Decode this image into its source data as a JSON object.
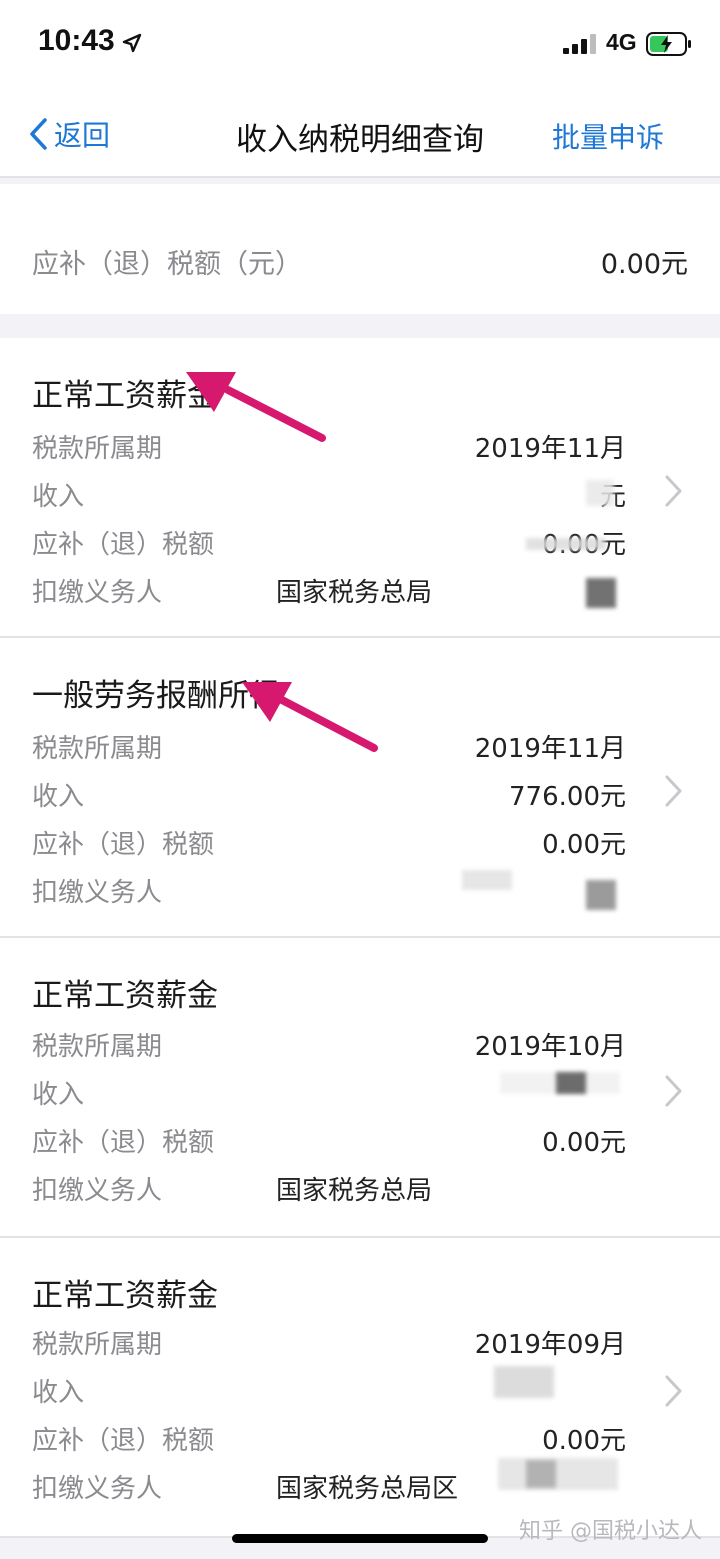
{
  "status_bar": {
    "time": "10:43",
    "network": "4G",
    "icons": [
      "location-arrow-icon",
      "signal-icon",
      "battery-charging-icon"
    ]
  },
  "nav": {
    "back_label": "返回",
    "title": "收入纳税明细查询",
    "action_label": "批量申诉"
  },
  "summary": {
    "label": "应补（退）税额（元）",
    "value": "0.00元"
  },
  "labels": {
    "period": "税款所属期",
    "income": "收入",
    "tax": "应补（退）税额",
    "agent": "扣缴义务人"
  },
  "records": [
    {
      "title": "正常工资薪金",
      "period": "2019年11月",
      "income": "元",
      "tax": "0.00元",
      "agent": "国家税务总局"
    },
    {
      "title": "一般劳务报酬所得",
      "period": "2019年11月",
      "income": "776.00元",
      "tax": "0.00元",
      "agent": ""
    },
    {
      "title": "正常工资薪金",
      "period": "2019年10月",
      "income": "",
      "tax": "0.00元",
      "agent": "国家税务总局"
    },
    {
      "title": "正常工资薪金",
      "period": "2019年09月",
      "income": "",
      "tax": "0.00元",
      "agent": "国家税务总局区"
    }
  ],
  "colors": {
    "accent": "#1f78d6",
    "annotation": "#d6186e",
    "label_gray": "#8a8a8f",
    "background": "#f2f2f7"
  },
  "watermark": "知乎 @国税小达人"
}
